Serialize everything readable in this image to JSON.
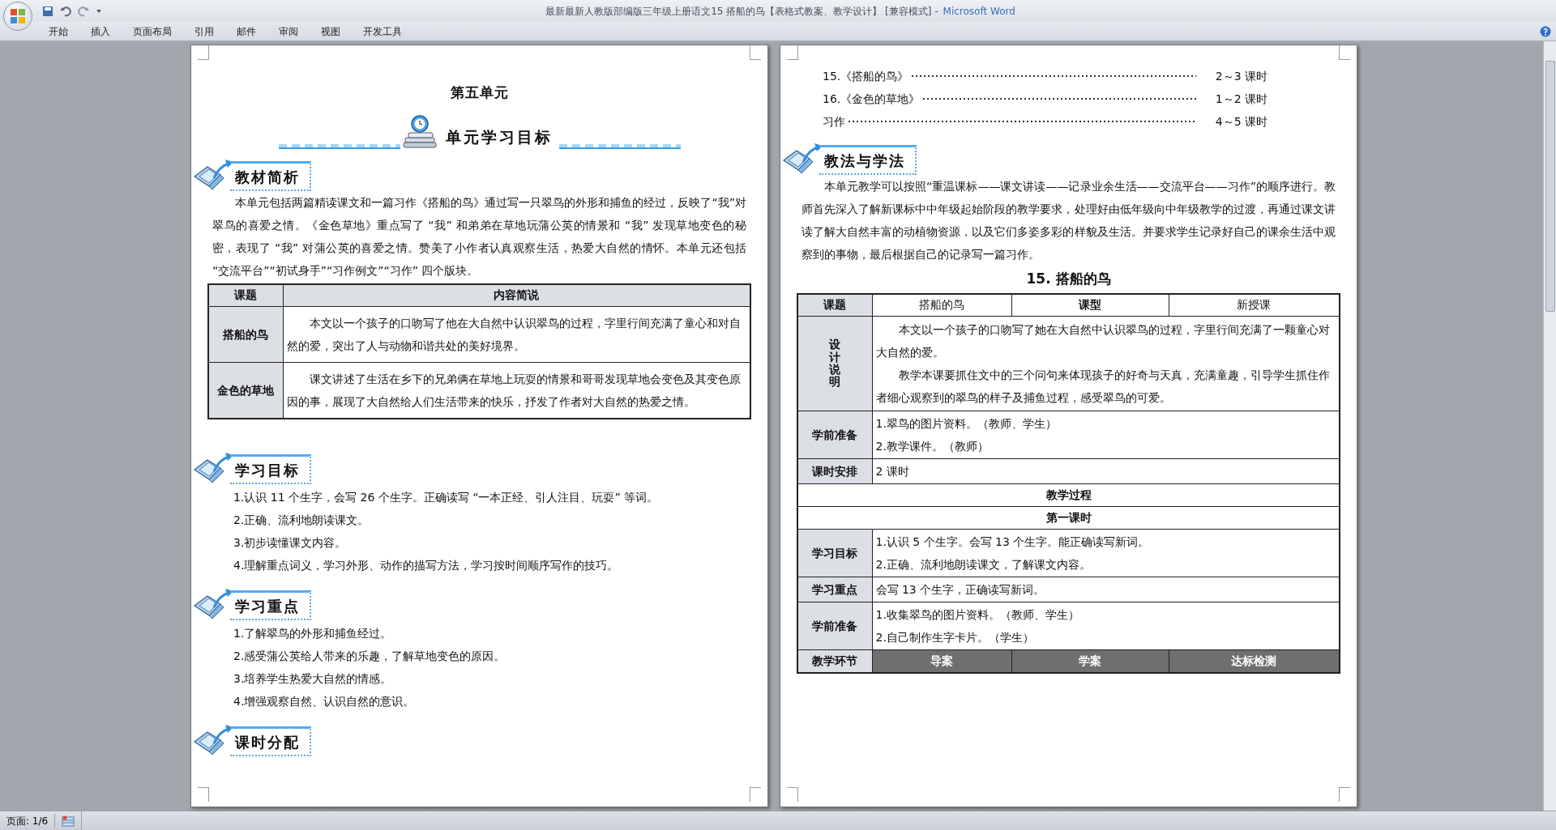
{
  "window": {
    "doc_title": "最新最新人教版部编版三年级上册语文15 搭船的鸟【表格式教案、教学设计】 [兼容模式] -",
    "app_name": "Microsoft Word"
  },
  "ribbon_tabs": [
    "开始",
    "插入",
    "页面布局",
    "引用",
    "邮件",
    "审阅",
    "视图",
    "开发工具"
  ],
  "left_page": [
    {
      "kind": "title",
      "text": "第五单元"
    },
    {
      "kind": "banner",
      "text": "单元学习目标"
    },
    {
      "kind": "heading",
      "text": "教材简析"
    },
    {
      "kind": "paragraph",
      "text": "本单元包括两篇精读课文和一篇习作《搭船的鸟》通过写一只翠鸟的外形和捕鱼的经过，反映了“我”对翠鸟的喜爱之情。《金色草地》重点写了 “我” 和弟弟在草地玩蒲公英的情景和 “我” 发现草地变色的秘密，表现了 “我” 对蒲公英的喜爱之情。赞美了小作者认真观察生活，热爱大自然的情怀。本单元还包括 “交流平台”“初试身手”“习作例文”“习作” 四个版块。"
    },
    {
      "kind": "summary_table",
      "columns": [
        "课题",
        "内容简说"
      ],
      "rows": [
        {
          "title": "搭船的鸟",
          "content": "本文以一个孩子的口吻写了他在大自然中认识翠鸟的过程，字里行间充满了童心和对自然的爱，突出了人与动物和谐共处的美好境界。"
        },
        {
          "title": "金色的草地",
          "content": "课文讲述了生活在乡下的兄弟俩在草地上玩耍的情景和哥哥发现草地会变色及其变色原因的事，展现了大自然给人们生活带来的快乐，抒发了作者对大自然的热爱之情。"
        }
      ]
    },
    {
      "kind": "spacer"
    },
    {
      "kind": "heading",
      "text": "学习目标"
    },
    {
      "kind": "list",
      "items": [
        "1.认识 11 个生字，会写 26 个生字。正确读写 “一本正经、引人注目、玩耍” 等词。",
        "2.正确、流利地朗读课文。",
        "3.初步读懂课文内容。",
        "4.理解重点词义，学习外形、动作的描写方法，学习按时间顺序写作的技巧。"
      ]
    },
    {
      "kind": "heading",
      "text": "学习重点"
    },
    {
      "kind": "list",
      "items": [
        "1.了解翠鸟的外形和捕鱼经过。",
        "2.感受蒲公英给人带来的乐趣，了解草地变色的原因。",
        "3.培养学生热爱大自然的情感。",
        "4.增强观察自然、认识自然的意识。"
      ]
    },
    {
      "kind": "heading",
      "text": "课时分配"
    }
  ],
  "right_page": [
    {
      "kind": "toc",
      "items": [
        {
          "label": "15.《搭船的鸟》",
          "value": "2～3 课时"
        },
        {
          "label": "16.《金色的草地》",
          "value": "1～2 课时"
        },
        {
          "label": "习作",
          "value": "4～5 课时"
        }
      ]
    },
    {
      "kind": "heading",
      "text": "教法与学法"
    },
    {
      "kind": "paragraph",
      "text": "本单元教学可以按照“重温课标——课文讲读——记录业余生活——交流平台——习作”的顺序进行。教师首先深入了解新课标中中年级起始阶段的教学要求，处理好由低年级向中年级教学的过渡，再通过课文讲读了解大自然丰富的动植物资源，以及它们多姿多彩的样貌及生活。并要求学生记录好自己的课余生活中观察到的事物，最后根据自己的记录写一篇习作。"
    },
    {
      "kind": "center_title",
      "text": "15. 搭船的鸟"
    },
    {
      "kind": "lesson_table",
      "rows": [
        {
          "kind": "quad",
          "cells": [
            "课题",
            "搭船的鸟",
            "课型",
            "新授课"
          ]
        },
        {
          "kind": "prose",
          "label": "设计说明",
          "lines": [
            "本文以一个孩子的口吻写了她在大自然中认识翠鸟的过程，字里行间充满了一颗童心对大自然的爱。",
            "教学本课要抓住文中的三个问句来体现孩子的好奇与天真，充满童趣，引导学生抓住作者细心观察到的翠鸟的样子及捕鱼过程，感受翠鸟的可爱。"
          ]
        },
        {
          "kind": "lines",
          "label": "学前准备",
          "lines": [
            "1.翠鸟的图片资料。（教师、学生）",
            "2.教学课件。（教师）"
          ]
        },
        {
          "kind": "lines",
          "label": "课时安排",
          "lines": [
            "2 课时"
          ]
        },
        {
          "kind": "full",
          "text": "教学过程"
        },
        {
          "kind": "full",
          "text": "第一课时"
        },
        {
          "kind": "lines",
          "label": "学习目标",
          "lines": [
            "1.认识 5 个生字。会写 13 个生字。能正确读写新词。",
            "2.正确、流利地朗读课文，了解课文内容。"
          ]
        },
        {
          "kind": "lines",
          "label": "学习重点",
          "lines": [
            "会写 13 个生字，正确读写新词。"
          ]
        },
        {
          "kind": "lines",
          "label": "学前准备",
          "lines": [
            "1.收集翠鸟的图片资料。（教师、学生）",
            "2.自己制作生字卡片。（学生）"
          ]
        },
        {
          "kind": "split",
          "label": "教学环节",
          "cells": [
            "导案",
            "学案",
            "达标检测"
          ]
        }
      ]
    }
  ],
  "status_bar": {
    "page": "页面: 1/6"
  }
}
